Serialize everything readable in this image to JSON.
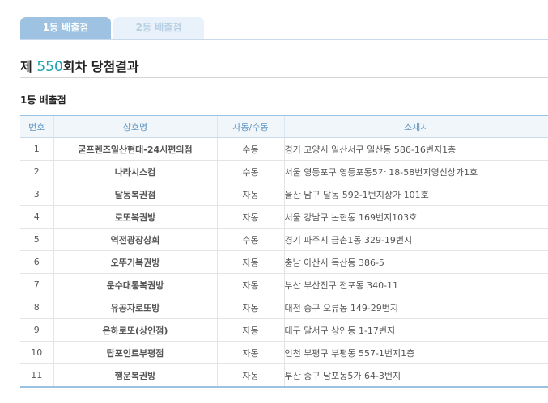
{
  "tabs": [
    {
      "label": "1등 배출점",
      "active": true
    },
    {
      "label": "2등 배출점",
      "active": false
    }
  ],
  "title": {
    "prefix": "제",
    "round": "550",
    "suffix": "회차 당첨결과"
  },
  "section": {
    "title": "1등 배출점"
  },
  "table": {
    "headers": [
      "번호",
      "상호명",
      "자동/수동",
      "소재지"
    ],
    "rows": [
      [
        "1",
        "굳프렌즈일산현대-24시편의점",
        "수동",
        "경기 고양시 일산서구 일산동 586-16번지1층"
      ],
      [
        "2",
        "나라시스컴",
        "수동",
        "서울 영등포구 영등포동5가 18-58번지영신상가1호"
      ],
      [
        "3",
        "달동복권점",
        "자동",
        "울산 남구 달동 592-1번지상가 101호"
      ],
      [
        "4",
        "로또복권방",
        "자동",
        "서울 강남구 논현동 169번지103호"
      ],
      [
        "5",
        "역전광장상회",
        "수동",
        "경기 파주시 금촌1동 329-19번지"
      ],
      [
        "6",
        "오뚜기복권방",
        "자동",
        "충남 아산시 득산동 386-5"
      ],
      [
        "7",
        "운수대통복권방",
        "자동",
        "부산 부산진구 전포동 340-11"
      ],
      [
        "8",
        "유공자로또방",
        "자동",
        "대전 중구 오류동 149-29번지"
      ],
      [
        "9",
        "은하로또(상인점)",
        "자동",
        "대구 달서구 상인동 1-17번지"
      ],
      [
        "10",
        "탑포인트부평점",
        "자동",
        "인천 부평구 부평동 557-1번지1층"
      ],
      [
        "11",
        "행운복권방",
        "자동",
        "부산 중구 남포동5가 64-3번지"
      ]
    ]
  }
}
